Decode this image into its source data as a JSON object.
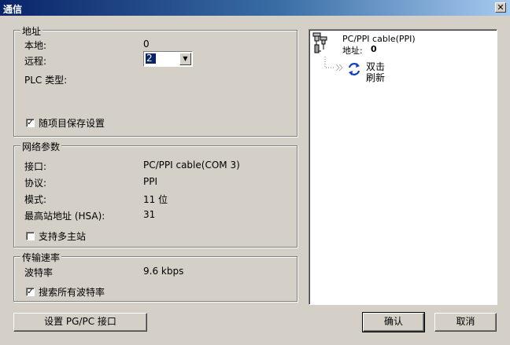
{
  "window": {
    "title": "通信",
    "close_glyph": "✕"
  },
  "address_group": {
    "title": "地址",
    "local_label": "本地:",
    "local_value": "0",
    "remote_label": "远程:",
    "remote_value": "2",
    "plc_type_label": "PLC 类型:",
    "save_with_project_label": "随项目保存设置",
    "save_with_project_checked": true
  },
  "network_group": {
    "title": "网络参数",
    "interface_label": "接口:",
    "interface_value": "PC/PPI cable(COM 3)",
    "protocol_label": "协议:",
    "protocol_value": "PPI",
    "mode_label": "模式:",
    "mode_value": "11 位",
    "hsa_label": "最高站地址 (HSA):",
    "hsa_value": "31",
    "multi_master_label": "支持多主站",
    "multi_master_checked": false
  },
  "baud_group": {
    "title": "传输速率",
    "baud_label": "波特率",
    "baud_value": "9.6 kbps",
    "search_all_label": "搜索所有波特率",
    "search_all_checked": true
  },
  "tree": {
    "cable_name": "PC/PPI cable(PPI)",
    "address_label": "地址:",
    "address_value": "0",
    "refresh_line1": "双击",
    "refresh_line2": "刷新"
  },
  "buttons": {
    "setup_pgpc": "设置 PG/PC 接口",
    "ok": "确认",
    "cancel": "取消"
  },
  "colors": {
    "title_start": "#0a246a",
    "title_end": "#a6caf0",
    "face": "#d4d0c8",
    "selection": "#0a246a",
    "refresh_icon": "#1040c0"
  }
}
